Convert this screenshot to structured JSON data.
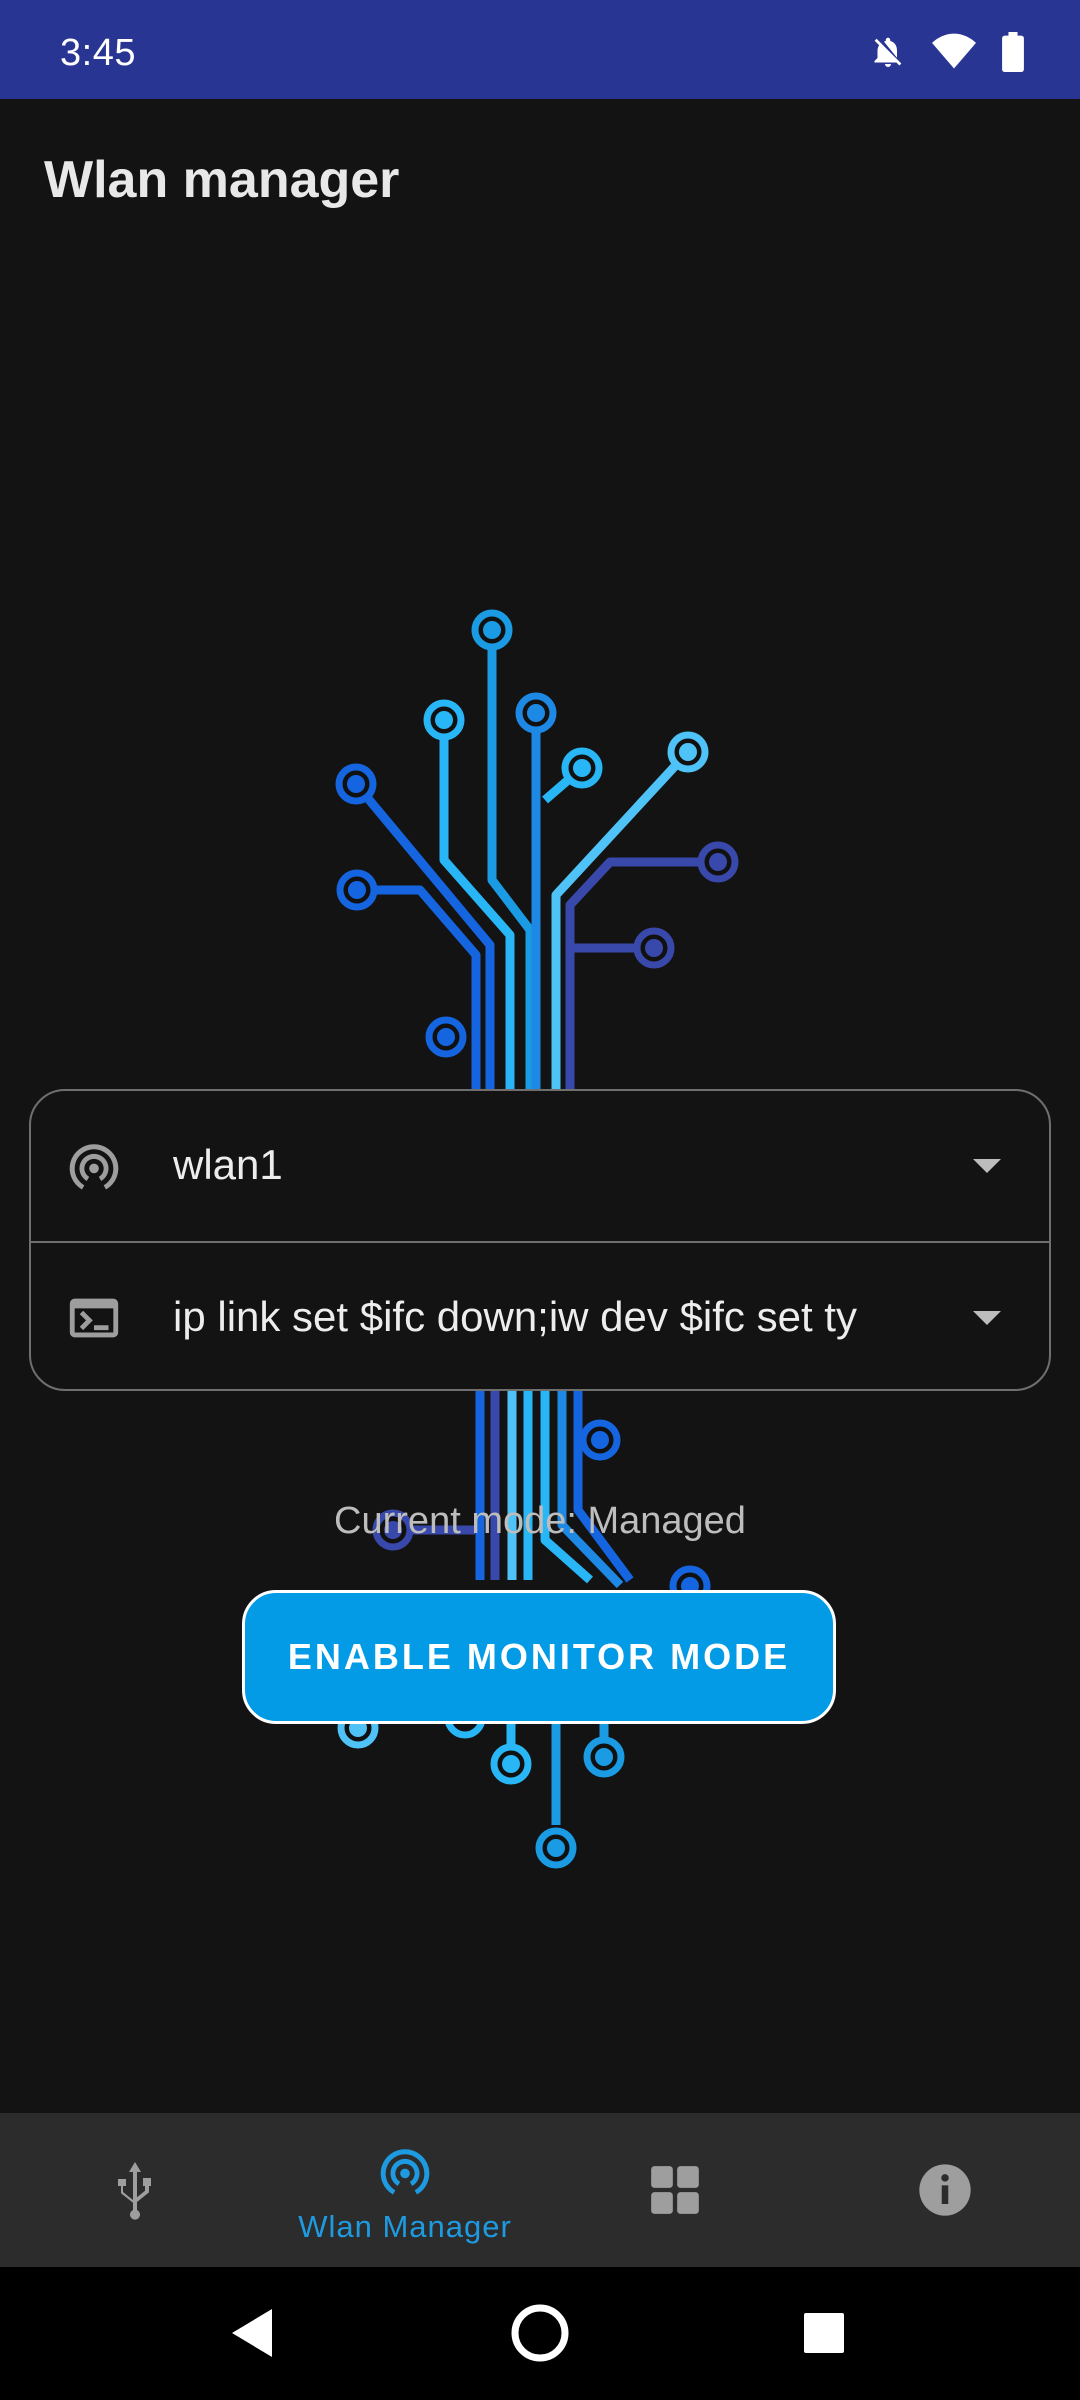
{
  "status_bar": {
    "time": "3:45",
    "icons": [
      "notifications-off-icon",
      "wifi-icon",
      "battery-icon"
    ]
  },
  "app_bar": {
    "title": "Wlan manager"
  },
  "interface_select": {
    "icon": "antenna-icon",
    "value": "wlan1"
  },
  "command_select": {
    "icon": "terminal-icon",
    "value": "ip link set $ifc down;iw dev $ifc set ty"
  },
  "status": {
    "current_mode_text": "Current mode: Managed"
  },
  "actions": {
    "primary_label": "ENABLE MONITOR MODE"
  },
  "bottom_nav": {
    "items": [
      {
        "icon": "usb-icon",
        "label": ""
      },
      {
        "icon": "antenna-icon",
        "label": "Wlan Manager",
        "active": true
      },
      {
        "icon": "grid-icon",
        "label": ""
      },
      {
        "icon": "info-icon",
        "label": ""
      }
    ]
  },
  "system_nav": {
    "icons": [
      "back-icon",
      "home-icon",
      "recents-icon"
    ]
  },
  "colors": {
    "status_bar": "#283593",
    "background": "#131313",
    "accent": "#039be5",
    "nav_background": "#2c2c2c",
    "nav_active": "#1e9be0"
  }
}
